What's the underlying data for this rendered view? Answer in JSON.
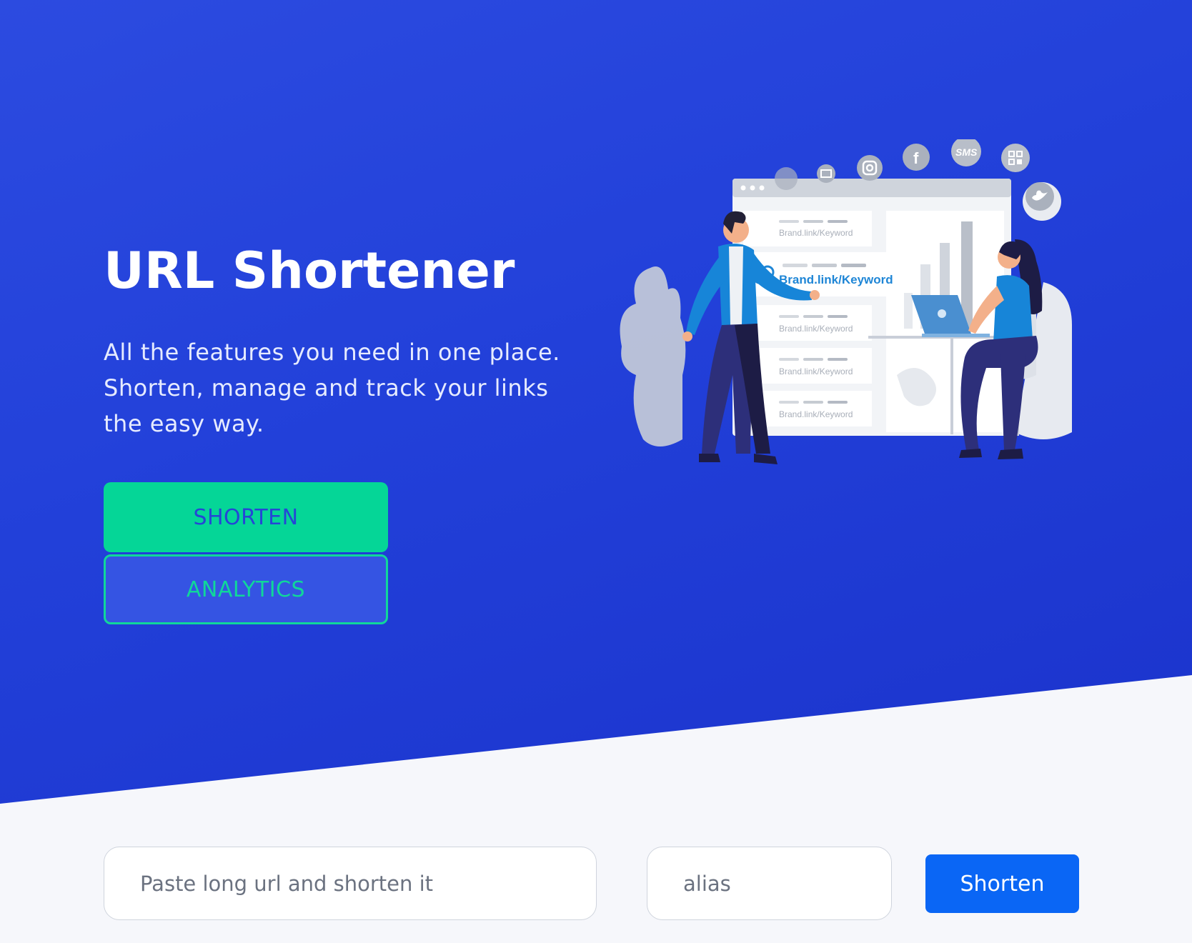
{
  "hero": {
    "title": "URL Shortener",
    "subtitle_lines": [
      "All the features you need in one place.",
      "Shorten, manage and track your links",
      "the easy way."
    ],
    "primary_button": "SHORTEN",
    "secondary_button": "ANALYTICS"
  },
  "illustration": {
    "link_rows": [
      "Brand.link/Keyword",
      "Brand.link/Keyword",
      "Brand.link/Keyword",
      "Brand.link/Keyword"
    ],
    "highlight_link": "Brand.link/Keyword",
    "sms_badge": "SMS",
    "icons": [
      "mail-icon",
      "instagram-icon",
      "facebook-icon",
      "sms-icon",
      "qr-code-icon",
      "twitter-icon",
      "link-icon",
      "laptop-icon"
    ]
  },
  "form": {
    "url_placeholder": "Paste long url and shorten it",
    "url_value": "",
    "alias_placeholder": "alias",
    "alias_value": "",
    "submit_label": "Shorten"
  },
  "colors": {
    "hero_bg": "#2541d9",
    "accent_green": "#05d697",
    "button_blue": "#0a66f5",
    "page_bg": "#f6f7fb"
  }
}
